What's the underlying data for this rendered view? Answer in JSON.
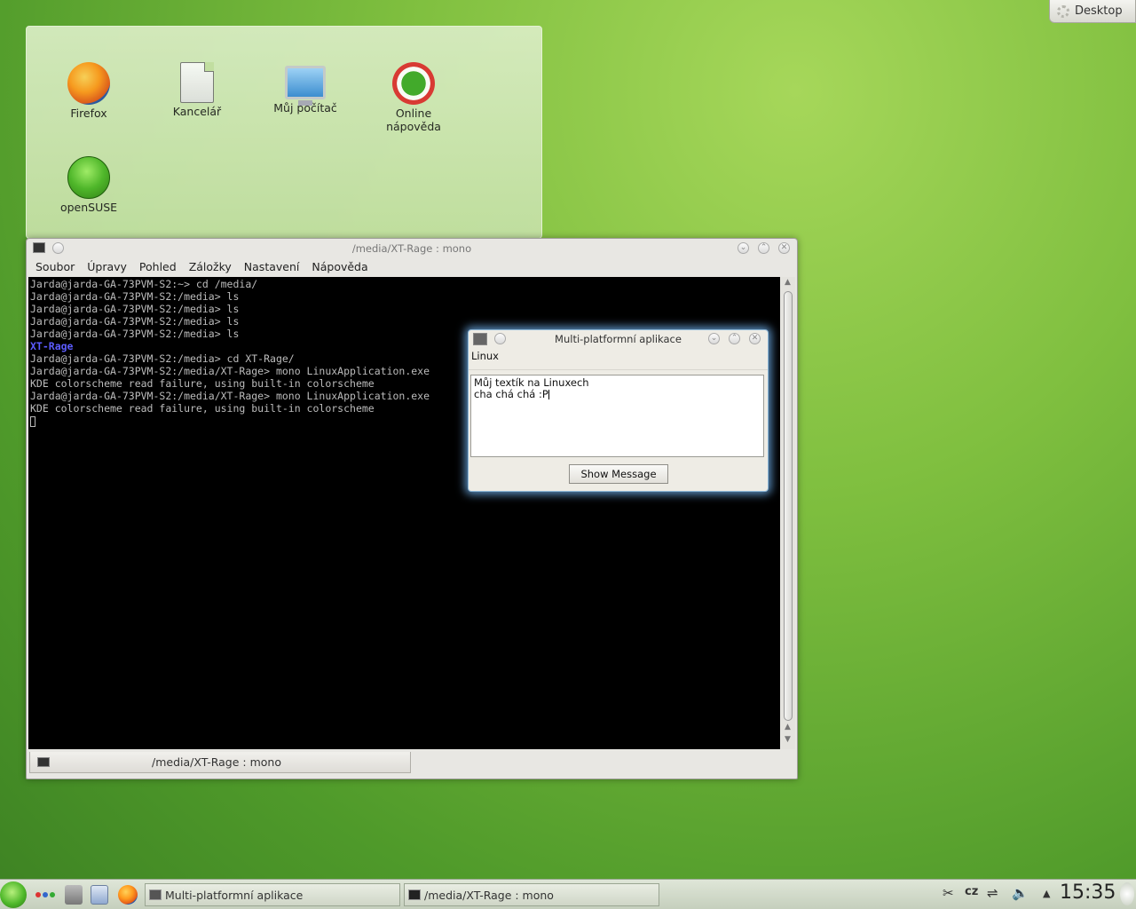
{
  "desktop": {
    "corner_button": "Desktop",
    "icons": [
      {
        "label": "Firefox",
        "icon": "firefox-icon"
      },
      {
        "label": "Kancelář",
        "icon": "office-document-icon"
      },
      {
        "label": "Můj počítač",
        "icon": "computer-icon"
      },
      {
        "label": "Online nápověda",
        "icon": "help-lifebuoy-icon"
      },
      {
        "label": "openSUSE",
        "icon": "opensuse-icon"
      }
    ]
  },
  "terminal": {
    "title": "/media/XT-Rage : mono",
    "menu": [
      "Soubor",
      "Úpravy",
      "Pohled",
      "Záložky",
      "Nastavení",
      "Nápověda"
    ],
    "lines": [
      "Jarda@jarda-GA-73PVM-S2:~> cd /media/",
      "Jarda@jarda-GA-73PVM-S2:/media> ls",
      "Jarda@jarda-GA-73PVM-S2:/media> ls",
      "Jarda@jarda-GA-73PVM-S2:/media> ls",
      "Jarda@jarda-GA-73PVM-S2:/media> ls",
      "XT-Rage",
      "Jarda@jarda-GA-73PVM-S2:/media> cd XT-Rage/",
      "Jarda@jarda-GA-73PVM-S2:/media/XT-Rage> mono LinuxApplication.exe",
      "KDE colorscheme read failure, using built-in colorscheme",
      "Jarda@jarda-GA-73PVM-S2:/media/XT-Rage> mono LinuxApplication.exe",
      "KDE colorscheme read failure, using built-in colorscheme"
    ],
    "tab_label": "/media/XT-Rage : mono"
  },
  "dialog": {
    "title": "Multi-platformní aplikace",
    "label": "Linux",
    "text_line1": "Můj textík na Linuxech",
    "text_line2": "cha chá chá :P",
    "button": "Show Message"
  },
  "taskbar": {
    "tasks": [
      "Multi-platformní aplikace",
      "/media/XT-Rage : mono"
    ],
    "keyboard_layout": "cz",
    "clock": "15:35"
  }
}
